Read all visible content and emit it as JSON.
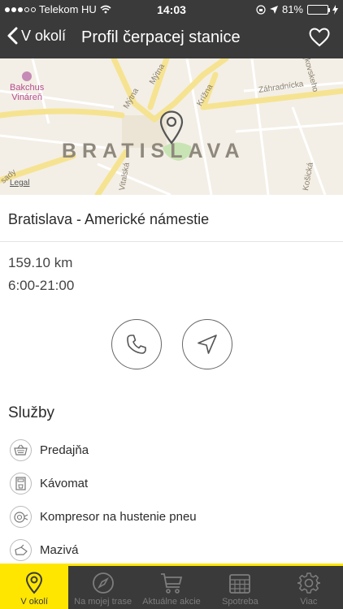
{
  "status_bar": {
    "carrier": "Telekom HU",
    "time": "14:03",
    "battery": "81%",
    "battery_level": 0.81
  },
  "nav": {
    "back_label": "V okolí",
    "title": "Profil čerpacej stanice"
  },
  "map": {
    "city_label": "BRATISLAVA",
    "poi_label_line1": "Bakchus",
    "poi_label_line2": "Vináreň",
    "legal": "Legal",
    "streets": {
      "mytna_1": "Mýtna",
      "mytna_2": "Mýtna",
      "kriznа": "Krížna",
      "zahradnicka": "Záhradnícka",
      "cajkovskeho": "Čajkovskeho",
      "vitalska": "Vitalská",
      "sady": "sady",
      "kosicka": "Košická"
    }
  },
  "station": {
    "name": "Bratislava - Americké námestie",
    "distance": "159.10 km",
    "hours": "6:00-21:00"
  },
  "services": {
    "title": "Služby",
    "items": [
      {
        "label": "Predajňa",
        "icon": "shop-basket-icon"
      },
      {
        "label": "Kávomat",
        "icon": "coffee-machine-icon"
      },
      {
        "label": "Kompresor na hustenie pneu",
        "icon": "tire-compressor-icon"
      },
      {
        "label": "Mazivá",
        "icon": "oil-can-icon"
      }
    ]
  },
  "tabs": [
    {
      "label": "V okolí",
      "icon": "location-pin-icon",
      "active": true
    },
    {
      "label": "Na mojej trase",
      "icon": "compass-icon",
      "active": false
    },
    {
      "label": "Aktuálne akcie",
      "icon": "shopping-cart-icon",
      "active": false
    },
    {
      "label": "Spotreba",
      "icon": "calendar-grid-icon",
      "active": false
    },
    {
      "label": "Viac",
      "icon": "gear-icon",
      "active": false
    }
  ],
  "colors": {
    "bar_background": "#3a3a3a",
    "accent_yellow": "#ffe600",
    "battery_green": "#4cd964"
  }
}
